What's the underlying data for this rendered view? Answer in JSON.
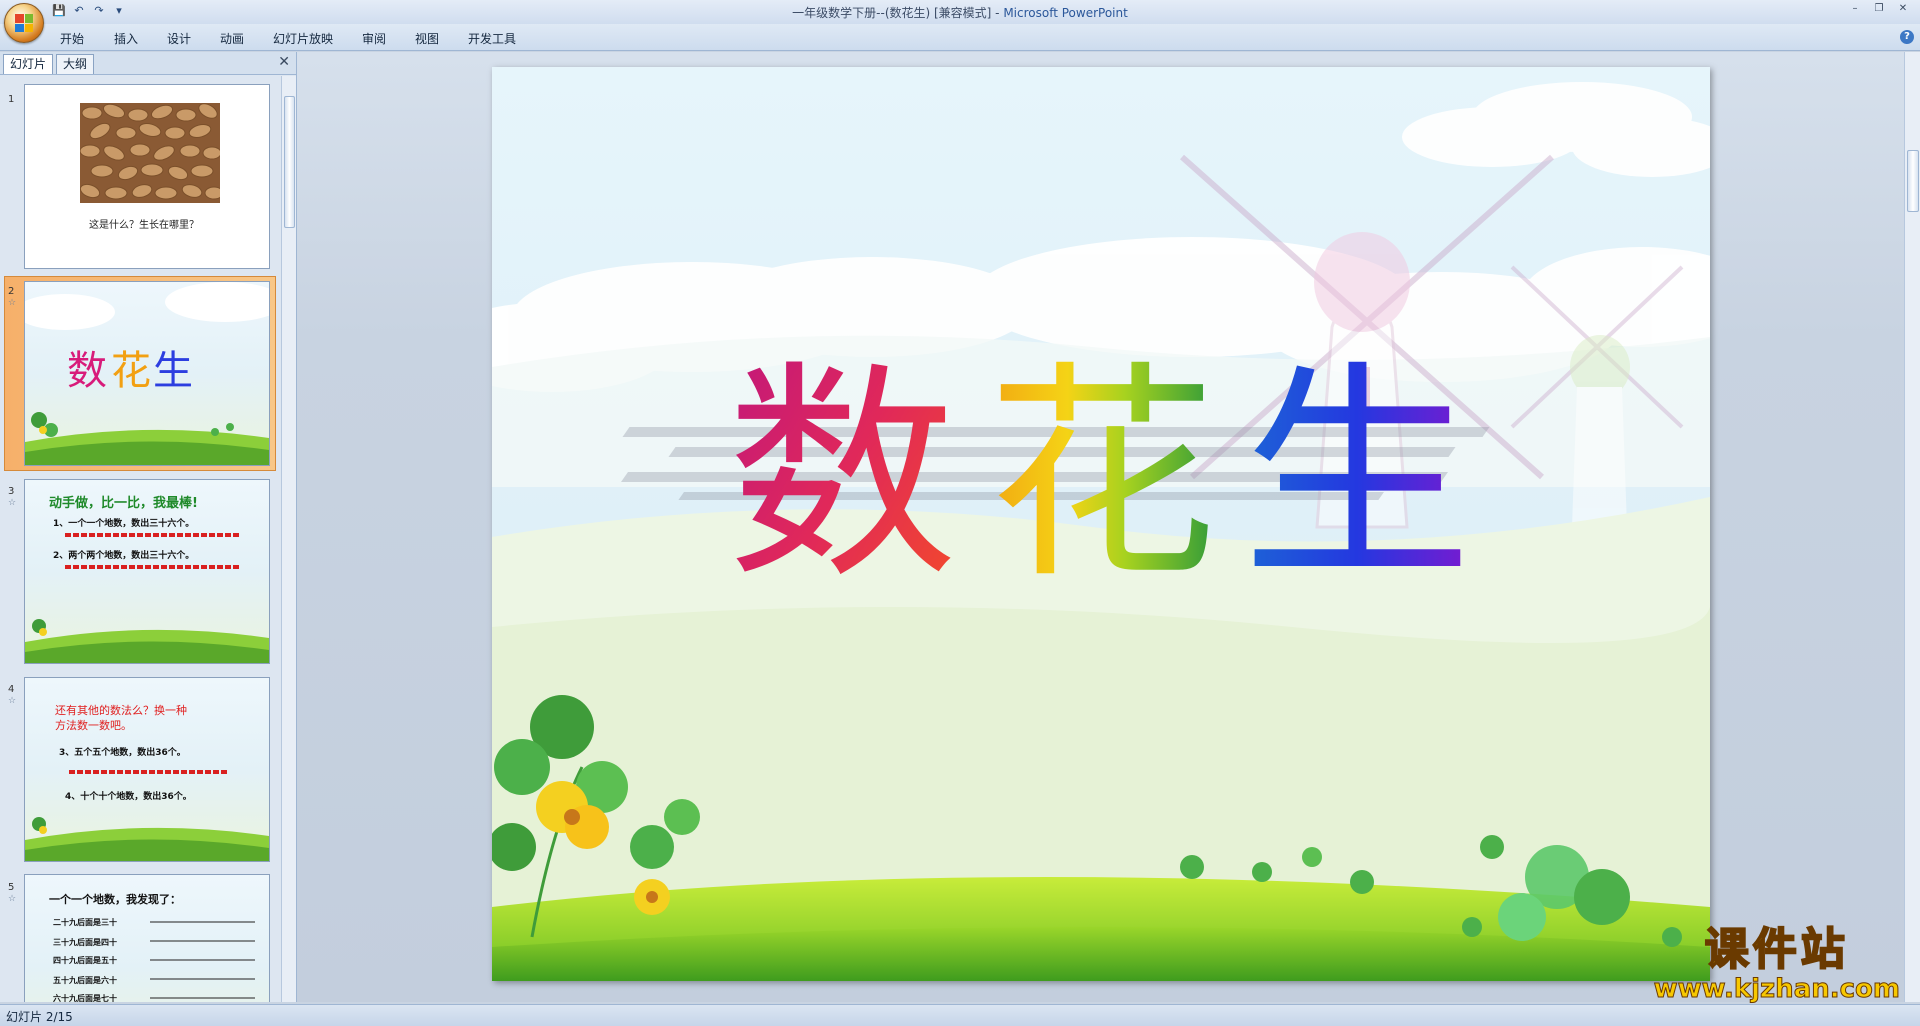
{
  "window": {
    "title": "一年级数学下册--(数花生) [兼容模式] - ",
    "app_name": "Microsoft PowerPoint",
    "controls": [
      "–",
      "❐",
      "✕"
    ]
  },
  "qat": {
    "save_icon": "💾",
    "undo_icon": "↶",
    "redo_icon": "↷",
    "more_icon": "▾"
  },
  "ribbon": {
    "tabs": [
      "开始",
      "插入",
      "设计",
      "动画",
      "幻灯片放映",
      "审阅",
      "视图",
      "开发工具"
    ],
    "help": "?"
  },
  "pane": {
    "tabs": [
      "幻灯片",
      "大纲"
    ],
    "close": "✕"
  },
  "thumbnails": [
    {
      "num": "1",
      "caption": "这是什么？生长在哪里？"
    },
    {
      "num": "2",
      "title_chars": [
        "数",
        "花",
        "生"
      ]
    },
    {
      "num": "3",
      "heading": "动手做，比一比，我最棒!",
      "line1": "1、一个一个地数，数出三十六个。",
      "line2": "2、两个两个地数，数出三十六个。"
    },
    {
      "num": "4",
      "heading": "还有其他的数法么？换一种",
      "heading2": "方法数一数吧。",
      "line1": "3、五个五个地数，数出36个。",
      "line2": "4、十个十个地数，数出36个。"
    },
    {
      "num": "5",
      "heading": "一个一个地数，我发现了：",
      "rows": [
        "二十九后面是三十",
        "三十九后面是四十",
        "四十九后面是五十",
        "五十九后面是六十",
        "六十九后面是七十"
      ]
    }
  ],
  "slide": {
    "title_chars": [
      "数",
      "花",
      "生"
    ],
    "colors": [
      "#d81b7a",
      "#f29a12",
      "#3b9b3a",
      "#2c3ee0"
    ]
  },
  "status": {
    "text": "幻灯片 2/15"
  },
  "watermark": {
    "main": "课件站",
    "url": "www.kjzhan.com"
  }
}
